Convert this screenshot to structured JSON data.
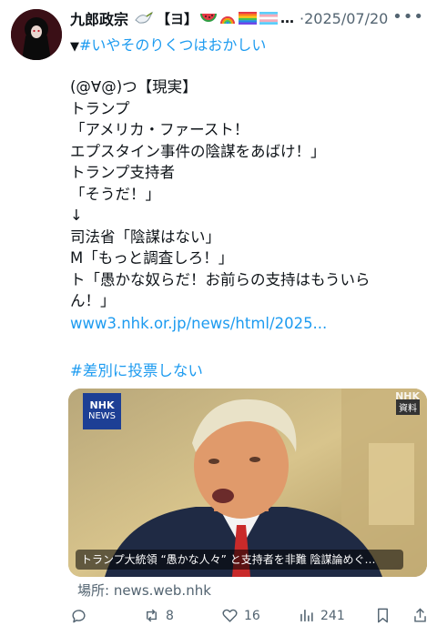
{
  "post": {
    "author": "九郎政宗",
    "emoji_badges": [
      "dove",
      "【ヨ】",
      "watermelon",
      "rainbow",
      "pride-flag",
      "trans-flag"
    ],
    "name_suffix": "…",
    "date": "·2025/07/20",
    "more_icon": "more-horizontal-icon",
    "header_hashtag_prefix": "▼",
    "header_hashtag": "#いやそのりくつはおかしい",
    "lines": [
      "(@∀@)つ【現実】",
      "トランプ",
      "「アメリカ・ファースト！",
      "エプスタイン事件の陰謀をあばけ！」",
      "トランプ支持者",
      "「そうだ！」",
      "↓",
      "司法省「陰謀はない」",
      "M「もっと調査しろ！」",
      "ト「愚かな奴らだ！お前らの支持はもういら",
      "ん！」"
    ],
    "url": "www3.nhk.or.jp/news/html/2025...",
    "hashtag2": "#差別に投票しない"
  },
  "card": {
    "logo_line1": "NHK",
    "logo_line2": "NEWS",
    "watermark": "NHK",
    "material_badge": "資料",
    "caption": "トランプ大統領 “愚かな人々” と支持者を非難 陰謀論めぐ…"
  },
  "source": {
    "label": "場所: news.web.nhk"
  },
  "actions": {
    "reply": {
      "icon": "reply-icon",
      "count": ""
    },
    "repost": {
      "icon": "repost-icon",
      "count": "8"
    },
    "like": {
      "icon": "heart-icon",
      "count": "16"
    },
    "views": {
      "icon": "views-icon",
      "count": "241"
    },
    "bookmark": {
      "icon": "bookmark-icon",
      "count": ""
    },
    "share": {
      "icon": "share-icon",
      "count": ""
    }
  },
  "colors": {
    "link": "#1d9bf0",
    "muted": "#536471",
    "text": "#0f1419"
  }
}
